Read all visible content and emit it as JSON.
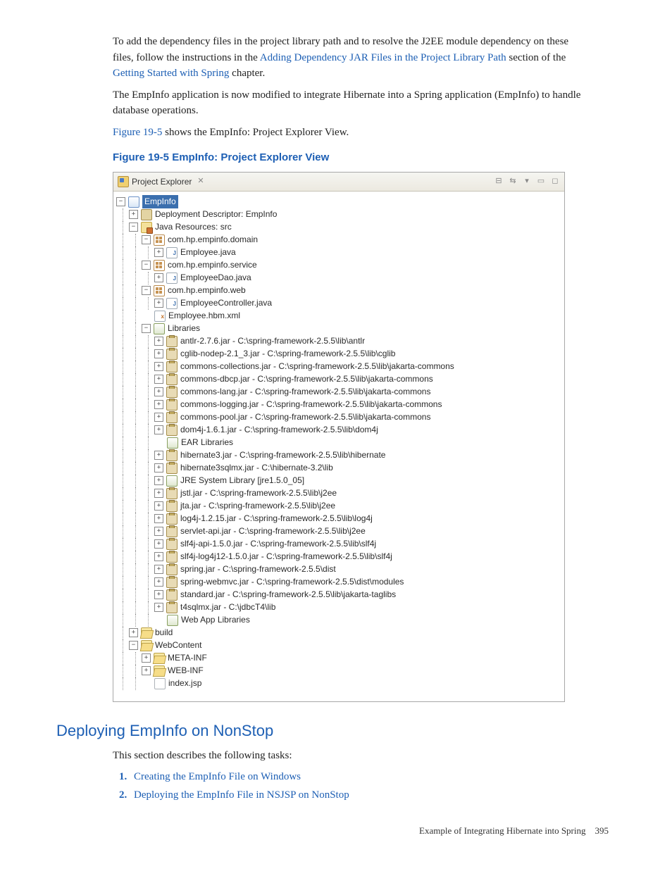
{
  "para1": {
    "t1": "To add the dependency ",
    "t2": " files in the project library path and to resolve the J2EE module dependency on these ",
    "t3": " files, follow the instructions in the ",
    "link1": "Adding Dependency JAR Files in the Project Library Path",
    "t4": " section of the ",
    "link2": "Getting Started with Spring",
    "t5": " chapter."
  },
  "para2": "The EmpInfo application is now modified to integrate Hibernate into a Spring application (EmpInfo) to handle database operations.",
  "para3": {
    "link": "Figure 19-5",
    "rest": " shows the EmpInfo: Project Explorer View."
  },
  "fig_caption": "Figure 19-5 EmpInfo: Project Explorer View",
  "tab": {
    "title": "Project Explorer"
  },
  "tree": {
    "root": "EmpInfo",
    "dd": "Deployment Descriptor: EmpInfo",
    "src": "Java Resources: src",
    "pkg_domain": "com.hp.empinfo.domain",
    "employee_java": "Employee.java",
    "pkg_service": "com.hp.empinfo.service",
    "employeedao_java": "EmployeeDao.java",
    "pkg_web": "com.hp.empinfo.web",
    "employeecontroller_java": "EmployeeController.java",
    "employee_hbm": "Employee.hbm.xml",
    "libraries": "Libraries",
    "jars": [
      "antlr-2.7.6.jar - C:\\spring-framework-2.5.5\\lib\\antlr",
      "cglib-nodep-2.1_3.jar - C:\\spring-framework-2.5.5\\lib\\cglib",
      "commons-collections.jar - C:\\spring-framework-2.5.5\\lib\\jakarta-commons",
      "commons-dbcp.jar - C:\\spring-framework-2.5.5\\lib\\jakarta-commons",
      "commons-lang.jar - C:\\spring-framework-2.5.5\\lib\\jakarta-commons",
      "commons-logging.jar - C:\\spring-framework-2.5.5\\lib\\jakarta-commons",
      "commons-pool.jar - C:\\spring-framework-2.5.5\\lib\\jakarta-commons",
      "dom4j-1.6.1.jar - C:\\spring-framework-2.5.5\\lib\\dom4j"
    ],
    "ear_lib": "EAR Libraries",
    "jars2": [
      "hibernate3.jar - C:\\spring-framework-2.5.5\\lib\\hibernate",
      "hibernate3sqlmx.jar - C:\\hibernate-3.2\\lib"
    ],
    "jre": "JRE System Library [jre1.5.0_05]",
    "jars3": [
      "jstl.jar - C:\\spring-framework-2.5.5\\lib\\j2ee",
      "jta.jar - C:\\spring-framework-2.5.5\\lib\\j2ee",
      "log4j-1.2.15.jar - C:\\spring-framework-2.5.5\\lib\\log4j",
      "servlet-api.jar - C:\\spring-framework-2.5.5\\lib\\j2ee",
      "slf4j-api-1.5.0.jar - C:\\spring-framework-2.5.5\\lib\\slf4j",
      "slf4j-log4j12-1.5.0.jar - C:\\spring-framework-2.5.5\\lib\\slf4j",
      "spring.jar - C:\\spring-framework-2.5.5\\dist",
      "spring-webmvc.jar - C:\\spring-framework-2.5.5\\dist\\modules",
      "standard.jar - C:\\spring-framework-2.5.5\\lib\\jakarta-taglibs",
      "t4sqlmx.jar - C:\\jdbcT4\\lib"
    ],
    "webapp_lib": "Web App Libraries",
    "build": "build",
    "webcontent": "WebContent",
    "metainf": "META-INF",
    "webinf": "WEB-INF",
    "indexjsp": "index.jsp"
  },
  "h2": "Deploying EmpInfo on NonStop",
  "para4": "This section describes the following tasks:",
  "steps": [
    {
      "a": "Creating the EmpInfo ",
      "b": " File on Windows"
    },
    {
      "a": "Deploying the EmpInfo ",
      "b": " File in NSJSP on NonStop"
    }
  ],
  "footer": {
    "text": "Example of Integrating Hibernate into Spring",
    "page": "395"
  }
}
